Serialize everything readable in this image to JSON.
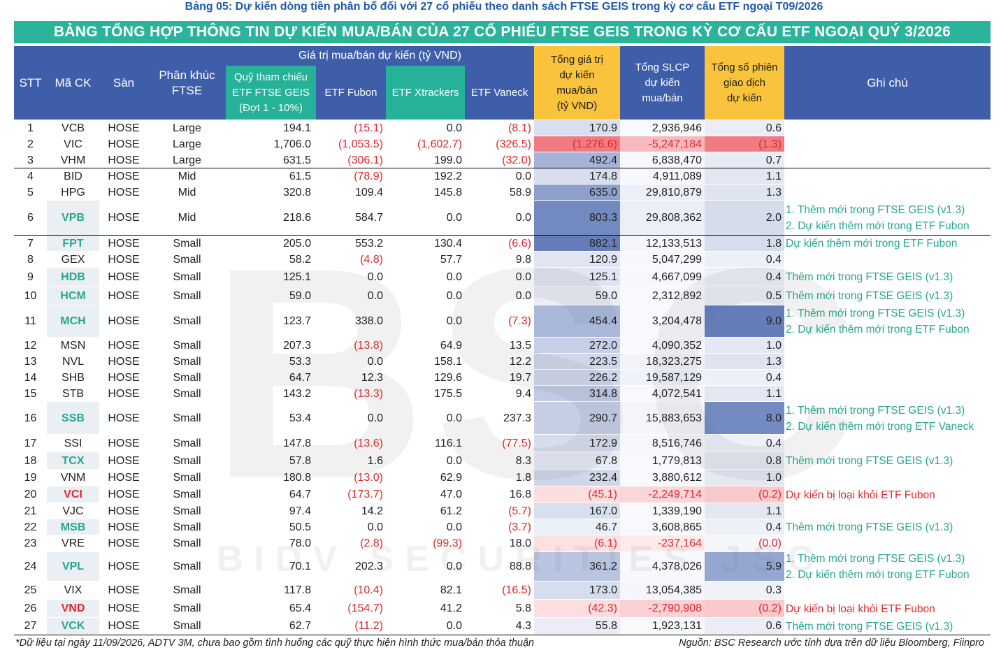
{
  "caption": "Bảng 05: Dự kiến dòng tiền phân bổ đối với 27 cổ phiếu theo danh sách FTSE GEIS trong kỳ cơ cấu ETF ngoại T09/2026",
  "title": "BẢNG TỔNG HỢP THÔNG TIN DỰ KIẾN MUA/BÁN CỦA 27 CỔ PHIẾU FTSE GEIS TRONG KỲ CƠ CẤU ETF NGOẠI QUÝ 3/2026",
  "watermark": {
    "logo": "BSC",
    "text": "BIDV SECURITIES JSC"
  },
  "header": {
    "stt": "STT",
    "ticker": "Mã CK",
    "exchange": "Sàn",
    "segment_l1": "Phân khúc",
    "segment_l2": "FTSE",
    "group": "Giá trị mua/bán dự kiến (tỷ VND)",
    "ftse_l1": "Quỹ tham chiếu",
    "ftse_l2": "ETF FTSE GEIS",
    "ftse_l3": "(Đợt 1 - 10%)",
    "fubon": "ETF Fubon",
    "xtrackers": "ETF Xtrackers",
    "vaneck": "ETF Vaneck",
    "total_l1": "Tổng giá trị",
    "total_l2": "dự kiến",
    "total_l3": "mua/bán",
    "total_l4": "(tỷ VND)",
    "slcp_l1": "Tổng SLCP",
    "slcp_l2": "dự kiến",
    "slcp_l3": "mua/bán",
    "sessions_l1": "Tổng số phiên",
    "sessions_l2": "giao dịch",
    "sessions_l3": "dự kiến",
    "notes": "Ghi chú"
  },
  "colors": {
    "header_blue": "#3e5ea9",
    "header_green": "#26b199",
    "header_yellow": "#f9c43b",
    "teal_text": "#26a68f",
    "negative": "#e0262a"
  },
  "rows": [
    {
      "stt": "1",
      "ticker": "VCB",
      "exchange": "HOSE",
      "segment": "Large",
      "ftse": "194.1",
      "fubon": "(15.1)",
      "xtrackers": "0.0",
      "vaneck": "(8.1)",
      "total": "170.9",
      "slcp": "2,936,946",
      "sessions": "0.6",
      "notes": [],
      "ticker_style": "plain"
    },
    {
      "stt": "2",
      "ticker": "VIC",
      "exchange": "HOSE",
      "segment": "Large",
      "ftse": "1,706.0",
      "fubon": "(1,053.5)",
      "xtrackers": "(1,602.7)",
      "vaneck": "(326.5)",
      "total": "(1,276.6)",
      "slcp": "-5,247,184",
      "sessions": "(1.3)",
      "notes": [],
      "ticker_style": "plain"
    },
    {
      "stt": "3",
      "ticker": "VHM",
      "exchange": "HOSE",
      "segment": "Large",
      "ftse": "631.5",
      "fubon": "(306.1)",
      "xtrackers": "199.0",
      "vaneck": "(32.0)",
      "total": "492.4",
      "slcp": "6,838,470",
      "sessions": "0.7",
      "notes": [],
      "ticker_style": "plain"
    },
    {
      "stt": "4",
      "ticker": "BID",
      "exchange": "HOSE",
      "segment": "Mid",
      "ftse": "61.5",
      "fubon": "(78.9)",
      "xtrackers": "192.2",
      "vaneck": "0.0",
      "total": "174.8",
      "slcp": "4,911,089",
      "sessions": "1.1",
      "notes": [],
      "ticker_style": "plain"
    },
    {
      "stt": "5",
      "ticker": "HPG",
      "exchange": "HOSE",
      "segment": "Mid",
      "ftse": "320.8",
      "fubon": "109.4",
      "xtrackers": "145.8",
      "vaneck": "58.9",
      "total": "635.0",
      "slcp": "29,810,879",
      "sessions": "1.3",
      "notes": [],
      "ticker_style": "plain"
    },
    {
      "stt": "6",
      "ticker": "VPB",
      "exchange": "HOSE",
      "segment": "Mid",
      "ftse": "218.6",
      "fubon": "584.7",
      "xtrackers": "0.0",
      "vaneck": "0.0",
      "total": "803.3",
      "slcp": "29,808,362",
      "sessions": "2.0",
      "notes": [
        "1. Thêm mới trong FTSE GEIS (v1.3)",
        "2. Dự kiến thêm mới trong ETF Fubon"
      ],
      "ticker_style": "teal"
    },
    {
      "stt": "7",
      "ticker": "FPT",
      "exchange": "HOSE",
      "segment": "Small",
      "ftse": "205.0",
      "fubon": "553.2",
      "xtrackers": "130.4",
      "vaneck": "(6.6)",
      "total": "882.1",
      "slcp": "12,133,513",
      "sessions": "1.8",
      "notes": [
        "Dự kiến thêm mới trong ETF Fubon"
      ],
      "ticker_style": "teal"
    },
    {
      "stt": "8",
      "ticker": "GEX",
      "exchange": "HOSE",
      "segment": "Small",
      "ftse": "58.2",
      "fubon": "(4.8)",
      "xtrackers": "57.7",
      "vaneck": "9.8",
      "total": "120.9",
      "slcp": "5,047,299",
      "sessions": "0.4",
      "notes": [],
      "ticker_style": "plain"
    },
    {
      "stt": "9",
      "ticker": "HDB",
      "exchange": "HOSE",
      "segment": "Small",
      "ftse": "125.1",
      "fubon": "0.0",
      "xtrackers": "0.0",
      "vaneck": "0.0",
      "total": "125.1",
      "slcp": "4,667,099",
      "sessions": "0.4",
      "notes": [
        "Thêm mới trong FTSE GEIS (v1.3)"
      ],
      "ticker_style": "teal"
    },
    {
      "stt": "10",
      "ticker": "HCM",
      "exchange": "HOSE",
      "segment": "Small",
      "ftse": "59.0",
      "fubon": "0.0",
      "xtrackers": "0.0",
      "vaneck": "0.0",
      "total": "59.0",
      "slcp": "2,312,892",
      "sessions": "0.5",
      "notes": [
        "Thêm mới trong FTSE GEIS (v1.3)"
      ],
      "ticker_style": "teal"
    },
    {
      "stt": "11",
      "ticker": "MCH",
      "exchange": "HOSE",
      "segment": "Small",
      "ftse": "123.7",
      "fubon": "338.0",
      "xtrackers": "0.0",
      "vaneck": "(7.3)",
      "total": "454.4",
      "slcp": "3,204,478",
      "sessions": "9.0",
      "notes": [
        "1. Thêm mới trong FTSE GEIS (v1.3)",
        "2. Dự kiến thêm mới trong ETF Fubon"
      ],
      "ticker_style": "teal"
    },
    {
      "stt": "12",
      "ticker": "MSN",
      "exchange": "HOSE",
      "segment": "Small",
      "ftse": "207.3",
      "fubon": "(13.8)",
      "xtrackers": "64.9",
      "vaneck": "13.5",
      "total": "272.0",
      "slcp": "4,090,352",
      "sessions": "1.0",
      "notes": [],
      "ticker_style": "plain"
    },
    {
      "stt": "13",
      "ticker": "NVL",
      "exchange": "HOSE",
      "segment": "Small",
      "ftse": "53.3",
      "fubon": "0.0",
      "xtrackers": "158.1",
      "vaneck": "12.2",
      "total": "223.5",
      "slcp": "18,323,275",
      "sessions": "1.3",
      "notes": [],
      "ticker_style": "plain"
    },
    {
      "stt": "14",
      "ticker": "SHB",
      "exchange": "HOSE",
      "segment": "Small",
      "ftse": "64.7",
      "fubon": "12.3",
      "xtrackers": "129.6",
      "vaneck": "19.7",
      "total": "226.2",
      "slcp": "19,587,129",
      "sessions": "0.4",
      "notes": [],
      "ticker_style": "plain"
    },
    {
      "stt": "15",
      "ticker": "STB",
      "exchange": "HOSE",
      "segment": "Small",
      "ftse": "143.2",
      "fubon": "(13.3)",
      "xtrackers": "175.5",
      "vaneck": "9.4",
      "total": "314.8",
      "slcp": "4,072,541",
      "sessions": "1.1",
      "notes": [],
      "ticker_style": "plain"
    },
    {
      "stt": "16",
      "ticker": "SSB",
      "exchange": "HOSE",
      "segment": "Small",
      "ftse": "53.4",
      "fubon": "0.0",
      "xtrackers": "0.0",
      "vaneck": "237.3",
      "total": "290.7",
      "slcp": "15,883,653",
      "sessions": "8.0",
      "notes": [
        "1. Thêm mới trong FTSE GEIS (v1.3)",
        "2. Dự kiến thêm mới trong ETF Vaneck"
      ],
      "ticker_style": "teal"
    },
    {
      "stt": "17",
      "ticker": "SSI",
      "exchange": "HOSE",
      "segment": "Small",
      "ftse": "147.8",
      "fubon": "(13.6)",
      "xtrackers": "116.1",
      "vaneck": "(77.5)",
      "total": "172.9",
      "slcp": "8,516,746",
      "sessions": "0.4",
      "notes": [],
      "ticker_style": "plain"
    },
    {
      "stt": "18",
      "ticker": "TCX",
      "exchange": "HOSE",
      "segment": "Small",
      "ftse": "57.8",
      "fubon": "1.6",
      "xtrackers": "0.0",
      "vaneck": "8.3",
      "total": "67.8",
      "slcp": "1,779,813",
      "sessions": "0.8",
      "notes": [
        "Thêm mới trong FTSE GEIS (v1.3)"
      ],
      "ticker_style": "teal"
    },
    {
      "stt": "19",
      "ticker": "VNM",
      "exchange": "HOSE",
      "segment": "Small",
      "ftse": "180.8",
      "fubon": "(13.0)",
      "xtrackers": "62.9",
      "vaneck": "1.8",
      "total": "232.4",
      "slcp": "3,880,612",
      "sessions": "1.0",
      "notes": [],
      "ticker_style": "plain"
    },
    {
      "stt": "20",
      "ticker": "VCI",
      "exchange": "HOSE",
      "segment": "Small",
      "ftse": "64.7",
      "fubon": "(173.7)",
      "xtrackers": "47.0",
      "vaneck": "16.8",
      "total": "(45.1)",
      "slcp": "-2,249,714",
      "sessions": "(0.2)",
      "notes": [
        "Dự kiến bị loại khỏi ETF Fubon"
      ],
      "ticker_style": "red"
    },
    {
      "stt": "21",
      "ticker": "VJC",
      "exchange": "HOSE",
      "segment": "Small",
      "ftse": "97.4",
      "fubon": "14.2",
      "xtrackers": "61.2",
      "vaneck": "(5.7)",
      "total": "167.0",
      "slcp": "1,339,190",
      "sessions": "1.1",
      "notes": [],
      "ticker_style": "plain"
    },
    {
      "stt": "22",
      "ticker": "MSB",
      "exchange": "HOSE",
      "segment": "Small",
      "ftse": "50.5",
      "fubon": "0.0",
      "xtrackers": "0.0",
      "vaneck": "(3.7)",
      "total": "46.7",
      "slcp": "3,608,865",
      "sessions": "0.4",
      "notes": [
        "Thêm mới trong FTSE GEIS (v1.3)"
      ],
      "ticker_style": "teal"
    },
    {
      "stt": "23",
      "ticker": "VRE",
      "exchange": "HOSE",
      "segment": "Small",
      "ftse": "78.0",
      "fubon": "(2.8)",
      "xtrackers": "(99.3)",
      "vaneck": "18.0",
      "total": "(6.1)",
      "slcp": "-237,164",
      "sessions": "(0.0)",
      "notes": [],
      "ticker_style": "plain"
    },
    {
      "stt": "24",
      "ticker": "VPL",
      "exchange": "HOSE",
      "segment": "Small",
      "ftse": "70.1",
      "fubon": "202.3",
      "xtrackers": "0.0",
      "vaneck": "88.8",
      "total": "361.2",
      "slcp": "4,378,026",
      "sessions": "5.9",
      "notes": [
        "1. Thêm mới trong FTSE GEIS (v1.3)",
        "2. Dự kiến thêm mới trong ETF Fubon"
      ],
      "ticker_style": "teal"
    },
    {
      "stt": "25",
      "ticker": "VIX",
      "exchange": "HOSE",
      "segment": "Small",
      "ftse": "117.8",
      "fubon": "(10.4)",
      "xtrackers": "82.1",
      "vaneck": "(16.5)",
      "total": "173.0",
      "slcp": "13,054,385",
      "sessions": "0.3",
      "notes": [],
      "ticker_style": "plain"
    },
    {
      "stt": "26",
      "ticker": "VND",
      "exchange": "HOSE",
      "segment": "Small",
      "ftse": "65.4",
      "fubon": "(154.7)",
      "xtrackers": "41.2",
      "vaneck": "5.8",
      "total": "(42.3)",
      "slcp": "-2,790,908",
      "sessions": "(0.2)",
      "notes": [
        "Dự kiến bị loại khỏi ETF Fubon"
      ],
      "ticker_style": "red"
    },
    {
      "stt": "27",
      "ticker": "VCK",
      "exchange": "HOSE",
      "segment": "Small",
      "ftse": "62.7",
      "fubon": "(11.2)",
      "xtrackers": "0.0",
      "vaneck": "4.3",
      "total": "55.8",
      "slcp": "1,923,131",
      "sessions": "0.6",
      "notes": [
        "Thêm mới trong FTSE GEIS (v1.3)"
      ],
      "ticker_style": "teal"
    }
  ],
  "footer": {
    "left": "*Dữ liệu tại ngày 11/09/2026, ADTV 3M, chưa bao gồm tình huống các quỹ thực hiện hình thức mua/bán thỏa thuận",
    "right": "Nguồn: BSC Research ước tính dựa trên dữ liệu Bloomberg, Fiinpro"
  }
}
